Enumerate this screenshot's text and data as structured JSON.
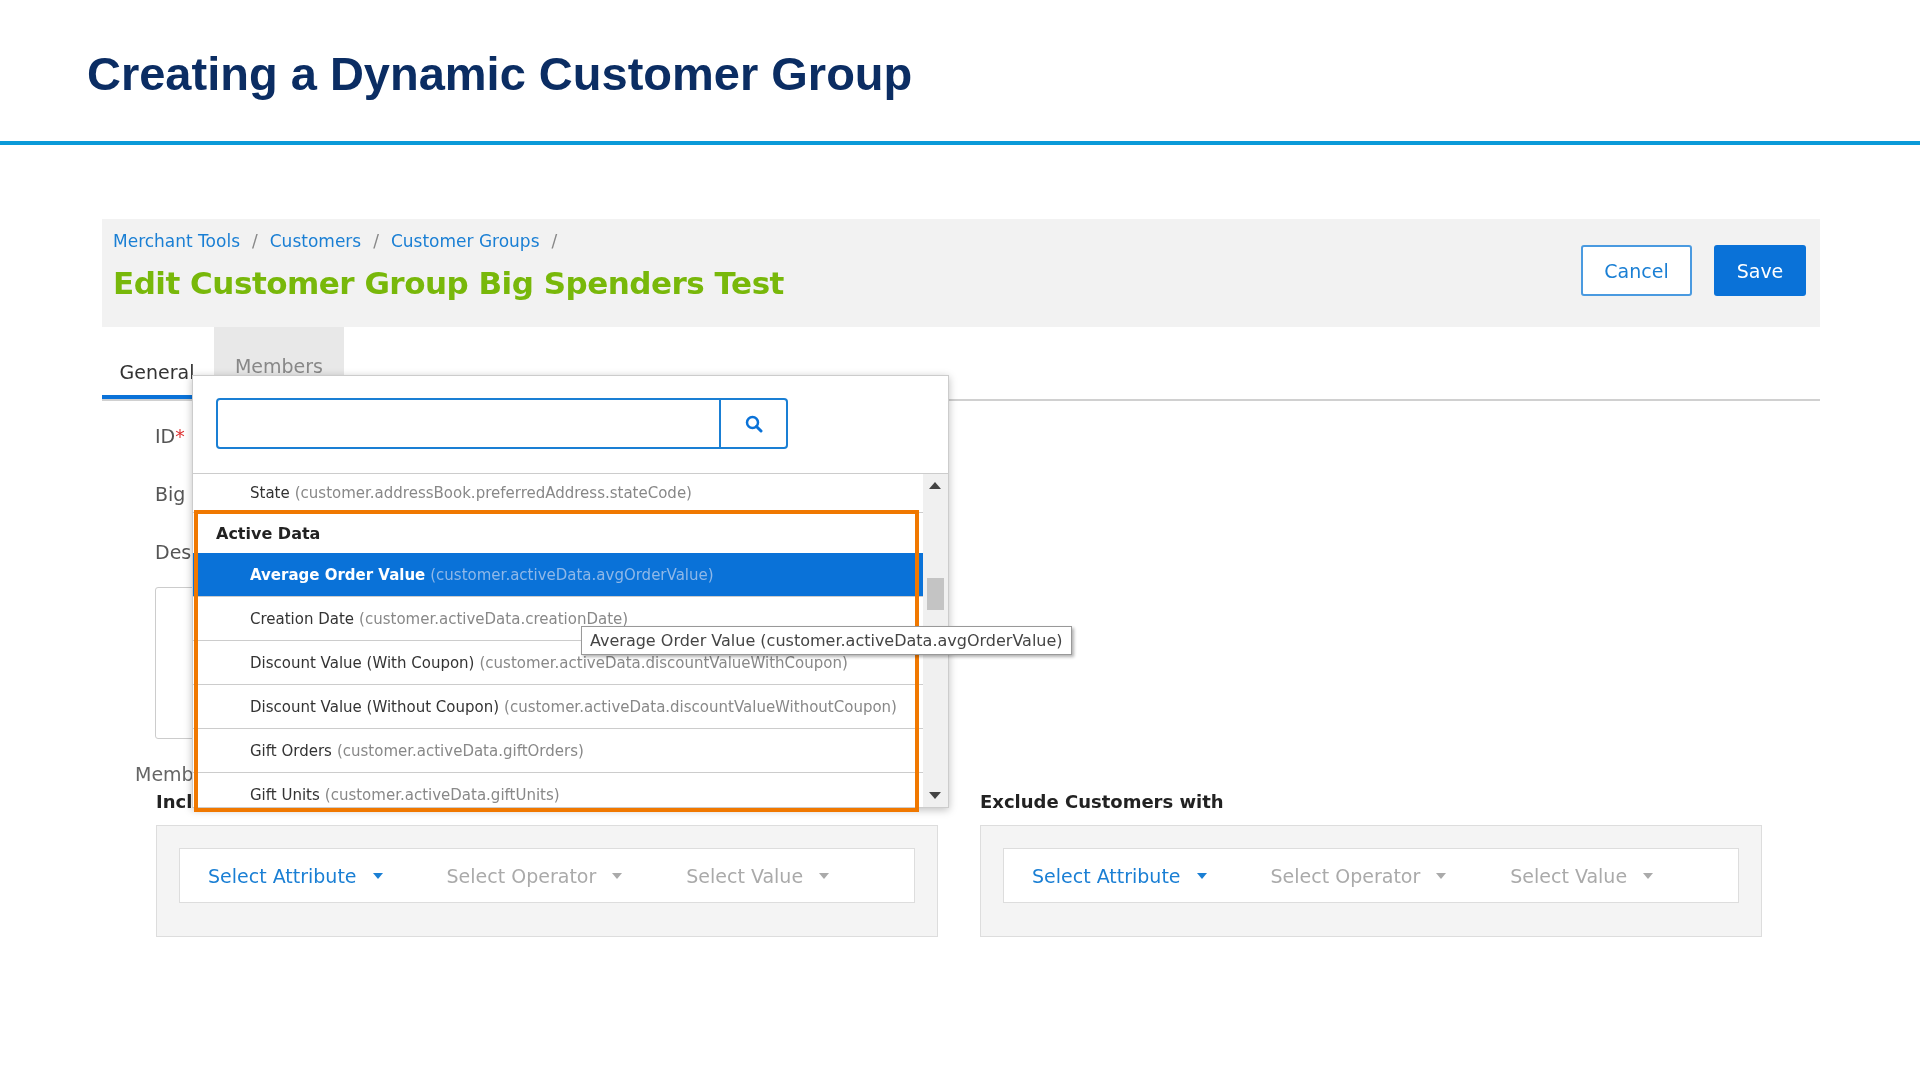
{
  "slide_title": "Creating a Dynamic Customer Group",
  "breadcrumbs": [
    {
      "label": "Merchant Tools",
      "separator": "/"
    },
    {
      "label": "Customers",
      "separator": "/"
    },
    {
      "label": "Customer Groups",
      "separator": "/"
    }
  ],
  "page_title": "Edit Customer Group Big Spenders Test",
  "buttons": [
    {
      "label": "Cancel",
      "kind": "secondary"
    },
    {
      "label": "Save",
      "kind": "primary"
    }
  ],
  "tabs": [
    {
      "label": "General",
      "selected": true
    },
    {
      "label": "Members",
      "selected": false
    }
  ],
  "form": {
    "fields": [
      {
        "label": "ID",
        "required_mark": "*"
      },
      {
        "label": "Big"
      },
      {
        "label": "Des"
      }
    ],
    "members_label": "Memb"
  },
  "attribute_dropdown": {
    "items": [
      {
        "kind": "option",
        "name": "State",
        "path": "(customer.addressBook.preferredAddress.stateCode)",
        "selected": false
      },
      {
        "kind": "group",
        "name": "Active Data"
      },
      {
        "kind": "option",
        "name": "Average Order Value",
        "path": "(customer.activeData.avgOrderValue)",
        "selected": true
      },
      {
        "kind": "option",
        "name": "Creation Date",
        "path": "(customer.activeData.creationDate)",
        "selected": false
      },
      {
        "kind": "option",
        "name": "Discount Value (With Coupon)",
        "path": "(customer.activeData.discountValueWithCoupon)",
        "selected": false
      },
      {
        "kind": "option",
        "name": "Discount Value (Without Coupon)",
        "path": "(customer.activeData.discountValueWithoutCoupon)",
        "selected": false
      },
      {
        "kind": "option",
        "name": "Gift Orders",
        "path": "(customer.activeData.giftOrders)",
        "selected": false
      },
      {
        "kind": "option",
        "name": "Gift Units",
        "path": "(customer.activeData.giftUnits)",
        "selected": false
      }
    ],
    "tooltip": "Average Order Value (customer.activeData.avgOrderValue)"
  },
  "rule_groups": [
    {
      "heading": "Incl",
      "selectors": [
        {
          "label": "Select Attribute",
          "disabled": false
        },
        {
          "label": "Select Operator",
          "disabled": true
        },
        {
          "label": "Select Value",
          "disabled": true
        }
      ]
    },
    {
      "heading": "Exclude Customers with",
      "selectors": [
        {
          "label": "Select Attribute",
          "disabled": false
        },
        {
          "label": "Select Operator",
          "disabled": true
        },
        {
          "label": "Select Value",
          "disabled": true
        }
      ]
    }
  ]
}
